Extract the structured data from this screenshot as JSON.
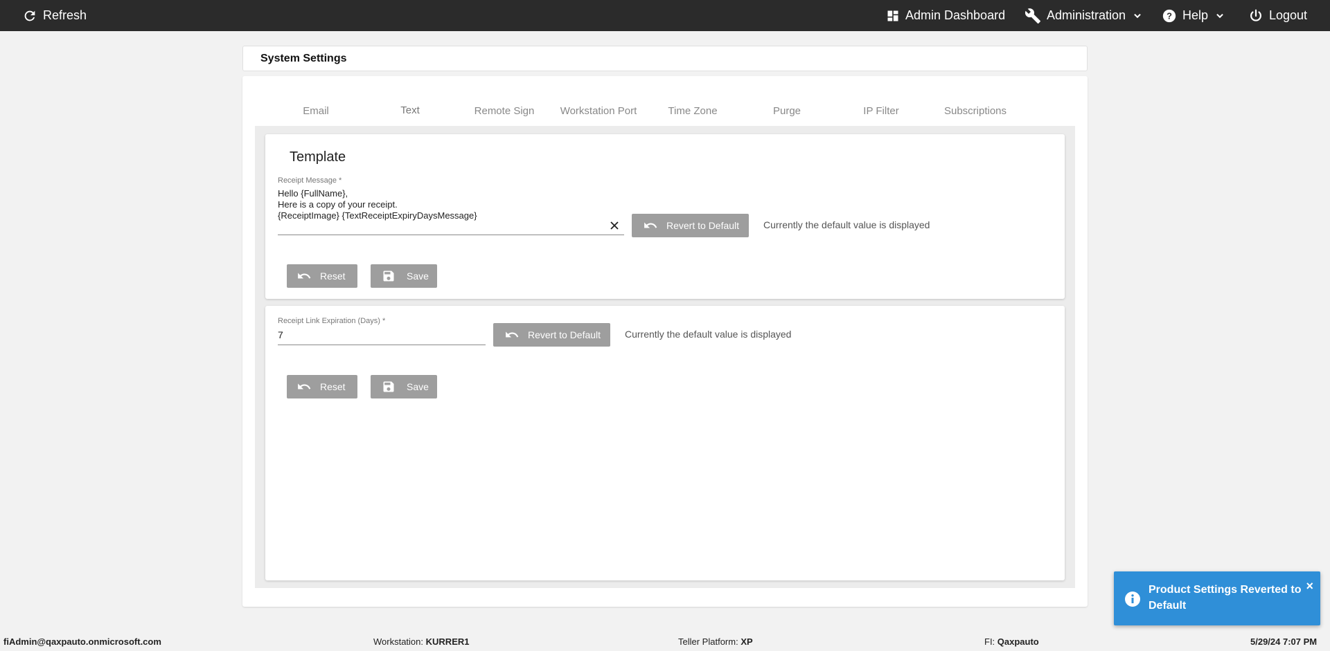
{
  "topbar": {
    "refresh_label": "Refresh",
    "admin_dashboard_label": "Admin Dashboard",
    "administration_label": "Administration",
    "help_label": "Help",
    "logout_label": "Logout"
  },
  "page": {
    "title": "System Settings"
  },
  "tabs": [
    {
      "label": "Email"
    },
    {
      "label": "Text"
    },
    {
      "label": "Remote Sign"
    },
    {
      "label": "Workstation Port"
    },
    {
      "label": "Time Zone"
    },
    {
      "label": "Purge"
    },
    {
      "label": "IP Filter"
    },
    {
      "label": "Subscriptions"
    }
  ],
  "active_tab": "Text",
  "template_section": {
    "title": "Template",
    "receipt_message": {
      "label": "Receipt Message *",
      "value": "Hello {FullName},\nHere is a copy of your receipt.\n{ReceiptImage} {TextReceiptExpiryDaysMessage}"
    },
    "revert_label": "Revert to Default",
    "status_text": "Currently the default value is displayed",
    "reset_label": "Reset",
    "save_label": "Save"
  },
  "expiration_section": {
    "field": {
      "label": "Receipt Link Expiration (Days) *",
      "value": "7"
    },
    "revert_label": "Revert to Default",
    "status_text": "Currently the default value is displayed",
    "reset_label": "Reset",
    "save_label": "Save"
  },
  "toast": {
    "message": "Product Settings Reverted to Default",
    "close_label": "×",
    "color": "#2f8fd8"
  },
  "footer": {
    "user": "fiAdmin@qaxpauto.onmicrosoft.com",
    "workstation_label": "Workstation:",
    "workstation_value": "KURRER1",
    "platform_label": "Teller Platform:",
    "platform_value": "XP",
    "fi_label": "FI:",
    "fi_value": "Qaxpauto",
    "datetime": "5/29/24 7:07 PM"
  },
  "colors": {
    "topbar": "#2b2b2b",
    "accent": "#3f51b5",
    "button": "#9e9e9e"
  }
}
